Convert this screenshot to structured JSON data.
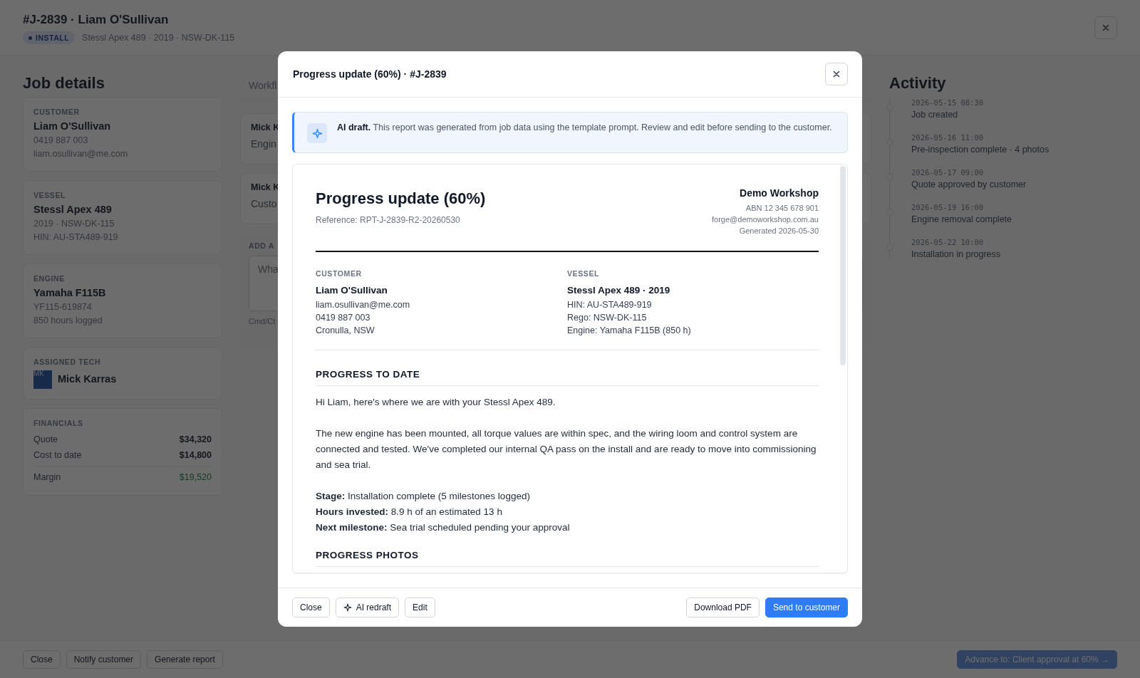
{
  "header": {
    "title": "#J-2839 · Liam O'Sullivan",
    "badge": "INSTALL",
    "subtitle": "Stessl Apex 489 · 2019 · NSW-DK-115"
  },
  "job_details": {
    "heading": "Job details",
    "cards": [
      {
        "kind": "info",
        "label": "CUSTOMER",
        "title": "Liam O'Sullivan",
        "lines": [
          "0419 887 003",
          "liam.osullivan@me.com"
        ]
      },
      {
        "kind": "info",
        "label": "VESSEL",
        "title": "Stessl Apex 489",
        "lines": [
          "2019 · NSW-DK-115",
          "HIN: AU-STA489-919"
        ]
      },
      {
        "kind": "info",
        "label": "ENGINE",
        "title": "Yamaha F115B",
        "lines": [
          "YF115-619874",
          "850 hours logged"
        ]
      },
      {
        "kind": "tech",
        "label": "ASSIGNED TECH",
        "avatar": "MK",
        "title": "Mick Karras"
      }
    ],
    "financials": {
      "label": "FINANCIALS",
      "rows": [
        {
          "kind": "plain",
          "label": "Quote",
          "value": "$34,320"
        },
        {
          "kind": "plain",
          "label": "Cost to date",
          "value": "$14,800"
        },
        {
          "kind": "total",
          "label": "Margin",
          "value": "$19,520"
        }
      ]
    }
  },
  "workflow": {
    "tab": "Workfl",
    "entries": [
      {
        "author": "Mick K",
        "text": "Engin"
      },
      {
        "author": "Mick K",
        "text": "Custo"
      }
    ],
    "note_label": "ADD A",
    "note_placeholder": "Wha",
    "hint": "Cmd/Ct"
  },
  "activity": {
    "heading": "Activity",
    "events": [
      {
        "time": "2026-05-15 08:30",
        "text": "Job created"
      },
      {
        "time": "2026-05-16 11:00",
        "text": "Pre-inspection complete · 4 photos"
      },
      {
        "time": "2026-05-17 09:00",
        "text": "Quote approved by customer"
      },
      {
        "time": "2026-05-19 16:00",
        "text": "Engine removal complete"
      },
      {
        "time": "2026-05-22 10:00",
        "text": "Installation in progress"
      }
    ]
  },
  "footer": {
    "buttons": [
      "Close",
      "Notify customer",
      "Generate report"
    ],
    "advance": {
      "label": "Advance to: Client approval at 60% →",
      "disabled": true
    }
  },
  "modal": {
    "title": "Progress update (60%) · #J-2839",
    "notice": "**AI draft.** This report was generated from job data using the template prompt. Review and edit before sending to the customer.",
    "report": {
      "title": "Progress update (60%)",
      "reference": "Reference: RPT-J-2839-R2-20260530",
      "company": {
        "name": "Demo Workshop",
        "lines": [
          "ABN 12 345 678 901",
          "forge@demoworkshop.com.au",
          "Generated 2026-05-30"
        ]
      },
      "parties": [
        {
          "label": "CUSTOMER",
          "name": "Liam O'Sullivan",
          "lines": [
            "liam.osullivan@me.com",
            "0419 887 003",
            "Cronulla, NSW"
          ]
        },
        {
          "label": "VESSEL",
          "name": "Stessl Apex 489 · 2019",
          "lines": [
            "HIN: AU-STA489-919",
            "Rego: NSW-DK-115",
            "Engine: Yamaha F115B (850 h)"
          ]
        }
      ],
      "sections": [
        {
          "heading": "PROGRESS TO DATE",
          "paragraphs": [
            "Hi Liam, here's where we are with your Stessl Apex 489.",
            "The new engine has been mounted, all torque values are within spec, and the wiring loom and control system are connected and tested. We've completed our internal QA pass on the install and are ready to move into commissioning and sea trial."
          ],
          "facts": [
            "**Stage:** Installation complete (5 milestones logged)",
            "**Hours invested:** 8.9 h of an estimated 13 h",
            "**Next milestone:** Sea trial scheduled pending your approval"
          ]
        },
        {
          "heading": "PROGRESS PHOTOS"
        }
      ]
    },
    "left_buttons": [
      {
        "kind": "plain",
        "label": "Close"
      },
      {
        "kind": "ai",
        "label": "AI redraft"
      },
      {
        "kind": "plain",
        "label": "Edit"
      }
    ],
    "right_buttons": [
      {
        "kind": "plain",
        "label": "Download PDF"
      },
      {
        "kind": "primary",
        "label": "Send to customer"
      }
    ]
  }
}
